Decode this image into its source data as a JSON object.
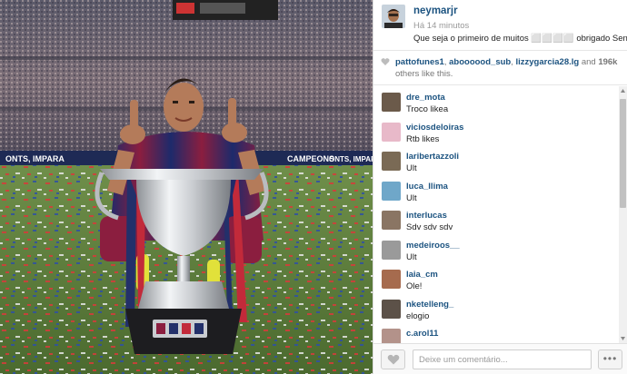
{
  "post": {
    "username": "neymarjr",
    "time": "Há 14 minutos",
    "caption": "Que seja o primeiro de muitos ⬜⬜⬜⬜ obrigado Senhor !!!!"
  },
  "photo": {
    "banner_left": "ONTS, IMPARA",
    "banner_mid": "CAMPEONS",
    "banner_right": "ONTS, IMPAR"
  },
  "likes": {
    "likers": [
      "pattofunes1",
      "aboooood_sub",
      "lizzygarcia28.lg"
    ],
    "and_label": "and",
    "count": "196k",
    "suffix": "others like this."
  },
  "comments": [
    {
      "user": "dre_mota",
      "text": "Troco likea",
      "avatar_color": "#6b5a4a"
    },
    {
      "user": "viciosdeloiras",
      "text": "Rtb likes",
      "avatar_color": "#e8b9c9"
    },
    {
      "user": "laribertazzoli",
      "text": "Ult",
      "avatar_color": "#7a6a55"
    },
    {
      "user": "luca_llima",
      "text": "Ult",
      "avatar_color": "#6fa7c9"
    },
    {
      "user": "interlucas",
      "text": "Sdv sdv sdv",
      "avatar_color": "#8a7563"
    },
    {
      "user": "medeiroos__",
      "text": "Ult",
      "avatar_color": "#9a9a9a"
    },
    {
      "user": "laia_cm",
      "text": "Ole!",
      "avatar_color": "#a66b4e"
    },
    {
      "user": "nketelleng_",
      "text": "elogio",
      "avatar_color": "#5c5148"
    },
    {
      "user": "c.arol11",
      "text": "",
      "avatar_color": "#b3928a"
    }
  ],
  "footer": {
    "comment_placeholder": "Deixe um comentário...",
    "more_label": "•••"
  }
}
